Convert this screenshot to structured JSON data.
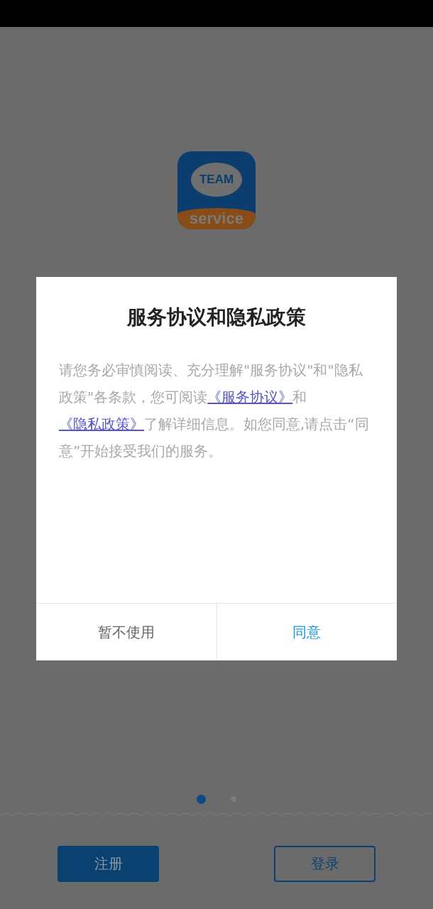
{
  "app_logo": {
    "top_text": "TEAM",
    "bottom_text": "service"
  },
  "dialog": {
    "title": "服务协议和隐私政策",
    "body": [
      {
        "kind": "text",
        "text": "请您务必审慎阅读、充分理解\"服务协议\"和\"隐私政策\"各条款，您可阅读"
      },
      {
        "kind": "link",
        "text": "《服务协议》"
      },
      {
        "kind": "text",
        "text": "和"
      },
      {
        "kind": "link",
        "text": "《隐私政策》"
      },
      {
        "kind": "text",
        "text": "了解详细信息。如您同意,请点击“同意”开始接受我们的服务。"
      }
    ],
    "buttons": [
      {
        "label": "暂不使用",
        "kind": "secondary"
      },
      {
        "label": "同意",
        "kind": "primary"
      }
    ]
  },
  "pager": [
    {
      "selected": true
    },
    {
      "selected": false
    }
  ],
  "buttons": [
    {
      "label": "注册",
      "kind": "filled"
    },
    {
      "label": "登录",
      "kind": "outline"
    }
  ]
}
